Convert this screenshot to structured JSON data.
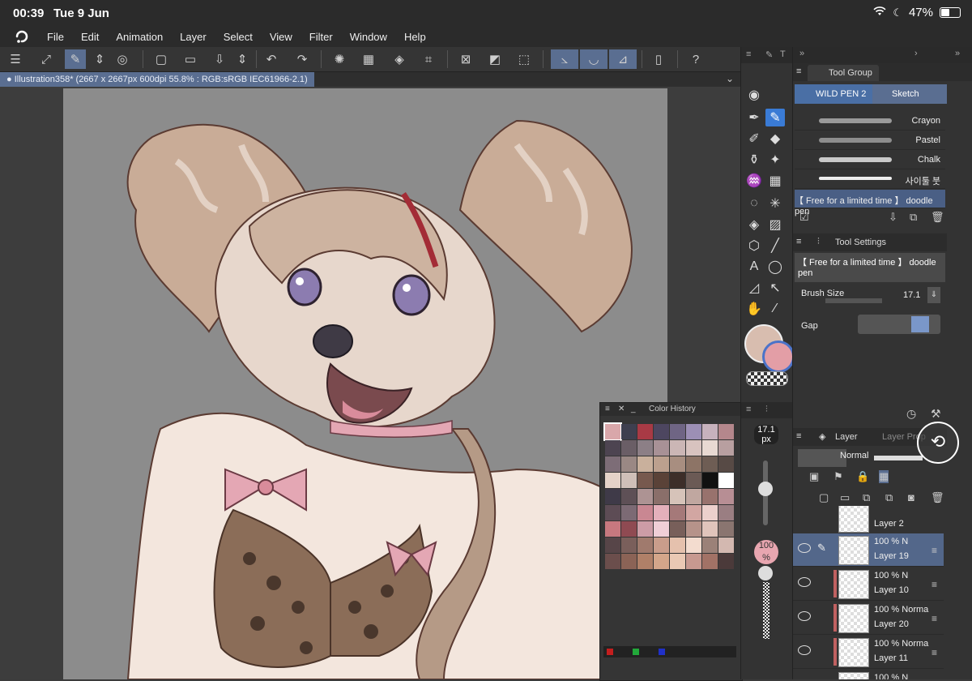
{
  "status": {
    "time": "00:39",
    "date": "Tue 9 Jun",
    "battery": "47%"
  },
  "menu": [
    "File",
    "Edit",
    "Animation",
    "Layer",
    "Select",
    "View",
    "Filter",
    "Window",
    "Help"
  ],
  "document": {
    "tab_label": "Illustration358* (2667 x 2667px 600dpi 55.8% : RGB:sRGB IEC61966-2.1)"
  },
  "color_history": {
    "title": "Color History",
    "swatches": [
      "#d9a7aa",
      "#3e3f4f",
      "#a83a45",
      "#4d4660",
      "#6f6584",
      "#9c8fb5",
      "#c7b2bd",
      "#b4878c",
      "#4d4451",
      "#6a5e66",
      "#8c7f86",
      "#a89196",
      "#cbb6b5",
      "#d8c3bf",
      "#e8d9d2",
      "#b89fa0",
      "#7d6d77",
      "#9a8884",
      "#c9b09c",
      "#bca08e",
      "#a88e80",
      "#8d7466",
      "#6e5d54",
      "#574a45",
      "#e4d2c8",
      "#cfbfb8",
      "#77594e",
      "#5a4238",
      "#3d2e29",
      "#6b5a55",
      "#111111",
      "#ffffff",
      "#3f3a48",
      "#5e5056",
      "#ad9393",
      "#8a6f6a",
      "#d6c3b9",
      "#c0a7a0",
      "#98726d",
      "#b78e94",
      "#5d4c55",
      "#7c6a74",
      "#c98792",
      "#e4b0bb",
      "#a57979",
      "#d2a6a2",
      "#ecd0cc",
      "#9a7e82",
      "#c7787f",
      "#8f4a52",
      "#cc9ca6",
      "#f0cfd7",
      "#785f5a",
      "#b6938a",
      "#e0c4bb",
      "#8a7570",
      "#574548",
      "#7a5f5b",
      "#a07a6d",
      "#c99d8b",
      "#e5c1ad",
      "#f3dccf",
      "#9b8178",
      "#d3b8b0",
      "#6b4e4c",
      "#8b6356",
      "#b08068",
      "#d4a68a",
      "#eac9b4",
      "#c79990",
      "#a27266",
      "#4b3a3a"
    ],
    "dot_colors": [
      "#c41e1e",
      "#22a83a",
      "#2030c8"
    ]
  },
  "tool_group": {
    "title": "Tool Group",
    "subtools": [
      "WILD PEN 2",
      "Sketch"
    ],
    "brushes": [
      "Crayon",
      "Pastel",
      "Chalk",
      "사이툴 붓",
      "【 Free for a limited time 】 doodle pen"
    ]
  },
  "tool_settings": {
    "title": "Tool Settings",
    "brush_name": "【 Free for a limited time 】 doodle pen",
    "brush_size_label": "Brush Size",
    "brush_size_value": "17.1",
    "gap_label": "Gap"
  },
  "size_indicator": {
    "value": "17.1",
    "unit": "px"
  },
  "opacity_indicator": "100 %",
  "layer_panel": {
    "title": "Layer",
    "tab2": "Layer Prop",
    "blend_mode": "Normal",
    "layers": [
      {
        "name": "Layer 2",
        "pct": "",
        "mode": ""
      },
      {
        "name": "Layer 19",
        "pct": "100 %",
        "mode": "N"
      },
      {
        "name": "Layer 10",
        "pct": "100 %",
        "mode": "N"
      },
      {
        "name": "Layer 20",
        "pct": "100 %",
        "mode": "Norma"
      },
      {
        "name": "Layer 11",
        "pct": "100 %",
        "mode": "Norma"
      },
      {
        "name": "",
        "pct": "100 %",
        "mode": "N"
      }
    ]
  }
}
